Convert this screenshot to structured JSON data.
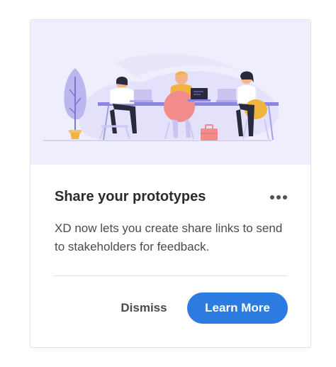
{
  "card": {
    "title": "Share your prototypes",
    "description": "XD now lets you create share links to send to stakeholders for feedback.",
    "more_icon": "more-horizontal-icon",
    "illustration": "team-working-at-desk-illustration"
  },
  "actions": {
    "dismiss_label": "Dismiss",
    "learn_more_label": "Learn More"
  },
  "colors": {
    "primary": "#2c7be0",
    "illustration_background": "#eeeefc",
    "title_text": "#2c2c2c",
    "body_text": "#4b4b4b"
  }
}
